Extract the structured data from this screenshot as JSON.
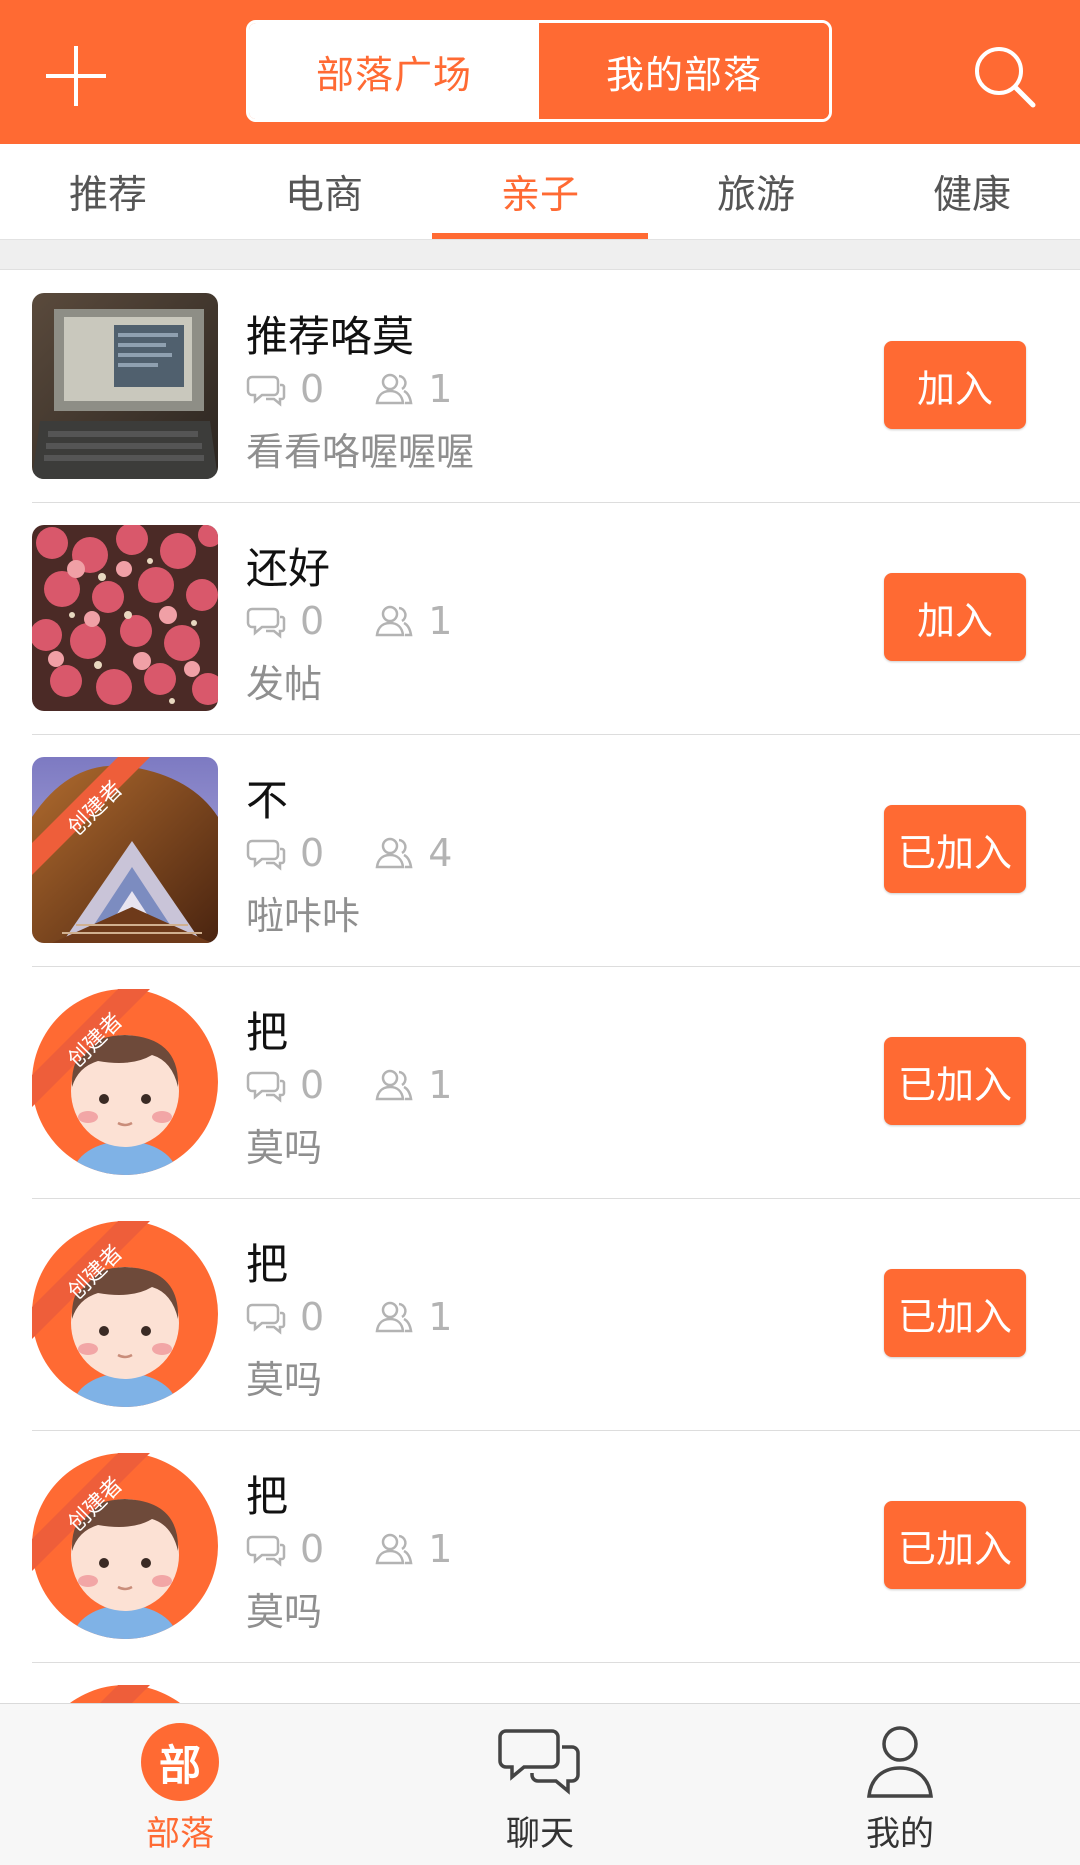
{
  "header": {
    "segments": [
      {
        "label": "部落广场",
        "active": true
      },
      {
        "label": "我的部落",
        "active": false
      }
    ],
    "left_icon": "plus-icon",
    "right_icon": "search-icon"
  },
  "categories": [
    {
      "label": "推荐",
      "active": false
    },
    {
      "label": "电商",
      "active": false
    },
    {
      "label": "亲子",
      "active": true
    },
    {
      "label": "旅游",
      "active": false
    },
    {
      "label": "健康",
      "active": false
    }
  ],
  "tribes": [
    {
      "title": "推荐咯莫",
      "comments": "0",
      "members": "1",
      "desc": "看看咯喔喔喔",
      "button": "加入",
      "thumb": "laptop-photo",
      "creator": false
    },
    {
      "title": "还好",
      "comments": "0",
      "members": "1",
      "desc": "发帖",
      "button": "加入",
      "thumb": "flowers-photo",
      "creator": false
    },
    {
      "title": "不",
      "comments": "0",
      "members": "4",
      "desc": "啦咔咔",
      "button": "已加入",
      "thumb": "building-photo",
      "creator": true
    },
    {
      "title": "把",
      "comments": "0",
      "members": "1",
      "desc": "莫吗",
      "button": "已加入",
      "thumb": "default-avatar",
      "creator": true
    },
    {
      "title": "把",
      "comments": "0",
      "members": "1",
      "desc": "莫吗",
      "button": "已加入",
      "thumb": "default-avatar",
      "creator": true
    },
    {
      "title": "把",
      "comments": "0",
      "members": "1",
      "desc": "莫吗",
      "button": "已加入",
      "thumb": "default-avatar",
      "creator": true
    },
    {
      "title": "",
      "comments": "",
      "members": "",
      "desc": "",
      "button": "",
      "thumb": "default-avatar",
      "creator": true
    }
  ],
  "creator_badge": "创建者",
  "tabbar": [
    {
      "label": "部落",
      "icon_text": "部",
      "icon": "tribe-icon",
      "active": true
    },
    {
      "label": "聊天",
      "icon": "chat-bubbles-icon",
      "active": false
    },
    {
      "label": "我的",
      "icon": "person-icon",
      "active": false
    }
  ],
  "colors": {
    "accent": "#FF6A33",
    "text_secondary": "#8f8f8f",
    "icon_gray": "#b3b3b3"
  }
}
